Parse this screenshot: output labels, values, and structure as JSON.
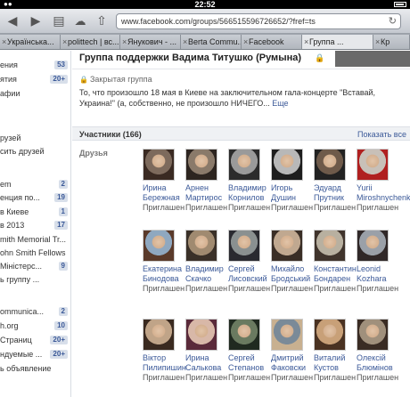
{
  "statusbar": {
    "time": "22:52"
  },
  "browser": {
    "url": "www.facebook.com/groups/566515596726652/?fref=ts",
    "tabs": [
      {
        "label": "Українська...",
        "active": false
      },
      {
        "label": "polittech | вс...",
        "active": false
      },
      {
        "label": "Янукович - ...",
        "active": false
      },
      {
        "label": "Berta Commu...",
        "active": false
      },
      {
        "label": "Facebook",
        "active": false
      },
      {
        "label": "Группа ...",
        "active": true
      },
      {
        "label": "Кр",
        "active": false
      }
    ]
  },
  "sidebar": {
    "items": [
      {
        "label": "ения",
        "badge": "53"
      },
      {
        "label": "ятия",
        "badge": "20+"
      },
      {
        "label": "афии",
        "badge": ""
      },
      {
        "label": "рузей",
        "badge": ""
      },
      {
        "label": "сить друзей",
        "badge": ""
      },
      {
        "label": "em",
        "badge": "2"
      },
      {
        "label": "енция по...",
        "badge": "19"
      },
      {
        "label": "в Киеве",
        "badge": "1"
      },
      {
        "label": "в 2013",
        "badge": "17"
      },
      {
        "label": "mith Memorial Tr...",
        "badge": ""
      },
      {
        "label": "ohn Smith Fellows",
        "badge": ""
      },
      {
        "label": "Міністерс...",
        "badge": "9"
      },
      {
        "label": "ь группу ...",
        "badge": ""
      },
      {
        "label": "ommunica...",
        "badge": "2"
      },
      {
        "label": "h.org",
        "badge": "10"
      },
      {
        "label": "Страниц",
        "badge": "20+"
      },
      {
        "label": "ндуемые ...",
        "badge": "20+"
      },
      {
        "label": "ь объявление",
        "badge": ""
      }
    ]
  },
  "group": {
    "title": "Группа поддержки Вадима Титушко (Румына)",
    "privacy": "Закрытая группа",
    "description": "То, что произошло 18 мая в Киеве на заключительном гала-концерте \"Вставай, Украина!\" (а, собственно, не произошло НИЧЕГО...",
    "more": "Еще"
  },
  "members": {
    "title": "Участники (166)",
    "show_all": "Показать все",
    "friends_label": "Друзья",
    "status_text": "Приглашен",
    "people": [
      {
        "name": "Ирина Бережная",
        "status": "Приглашен"
      },
      {
        "name": "Арнен Мартирос",
        "status": "Приглашен"
      },
      {
        "name": "Владимир Корнилов",
        "status": "Приглашен"
      },
      {
        "name": "Игорь Душин",
        "status": "Приглашен"
      },
      {
        "name": "Эдуард Прутник",
        "status": "Приглашен"
      },
      {
        "name": "Yurii Miroshnychenko",
        "status": "Приглашен"
      },
      {
        "name": "Екатерина Бинодова",
        "status": "Приглашен"
      },
      {
        "name": "Владимир Скачко",
        "status": "Приглашен"
      },
      {
        "name": "Сергей Лисовский",
        "status": "Приглашен"
      },
      {
        "name": "Михайло Бродський",
        "status": "Приглашен"
      },
      {
        "name": "Константин Бондарен",
        "status": "Приглашен"
      },
      {
        "name": "Leonid Kozhara",
        "status": "Приглашен"
      },
      {
        "name": "Віктор Пилипишин",
        "status": "Приглашен"
      },
      {
        "name": "Ирина Салькова",
        "status": "Приглашен"
      },
      {
        "name": "Сергей Степанов",
        "status": "Приглашен"
      },
      {
        "name": "Дмитрий Факовски",
        "status": "Приглашен"
      },
      {
        "name": "Виталий Кустов",
        "status": "Приглашен"
      },
      {
        "name": "Олексій Блюмінов",
        "status": "Приглашен"
      }
    ]
  },
  "colors": {
    "link": "#3b5998",
    "badge_bg": "#d8dfea"
  }
}
